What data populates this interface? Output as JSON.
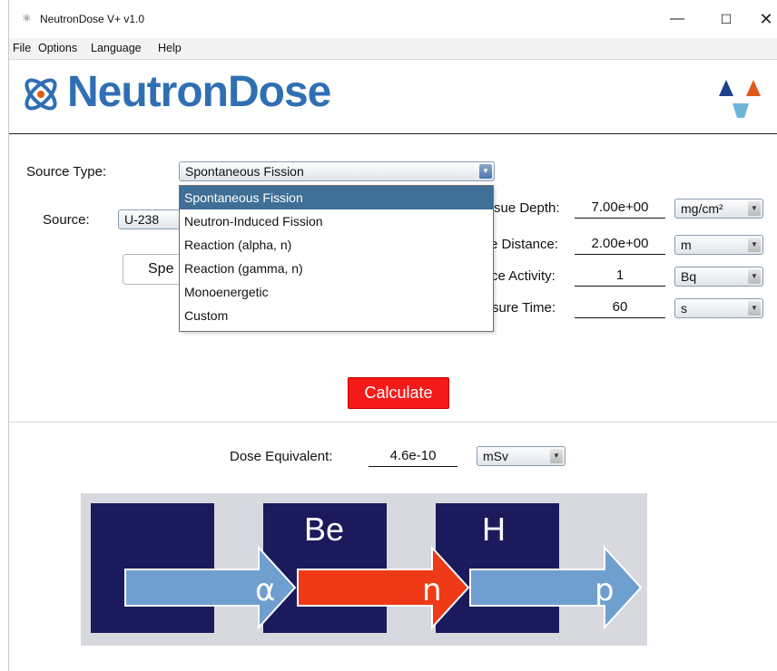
{
  "window": {
    "title": "NeutronDose  V+ v1.0",
    "controls": {
      "minimize": "—",
      "maximize": "☐",
      "close": "✕"
    }
  },
  "menu": [
    "File",
    "Options",
    "Language",
    "Help"
  ],
  "header": {
    "logo_text": "NeutronDose"
  },
  "form": {
    "source_type_label": "Source Type:",
    "source_type_value": "Spontaneous Fission",
    "source_label": "Source:",
    "source_value": "U-238",
    "spectrum_button_label": "Spe",
    "tissue_depth_label": "sue Depth:",
    "tissue_depth_value": "7.00e+00",
    "tissue_depth_unit": "mg/cm²",
    "distance_label": "e Distance:",
    "distance_value": "2.00e+00",
    "distance_unit": "m",
    "activity_label": "ce Activity:",
    "activity_value": "1",
    "activity_unit": "Bq",
    "time_label": "sure Time:",
    "time_value": "60",
    "time_unit": "s",
    "calculate_label": "Calculate"
  },
  "dropdown": {
    "options": [
      "Spontaneous Fission",
      "Neutron-Induced Fission",
      "Reaction (alpha, n)",
      "Reaction (gamma, n)",
      "Monoenergetic",
      "Custom"
    ],
    "selected_index": 0
  },
  "result": {
    "label": "Dose Equivalent:",
    "value": "4.6e-10",
    "unit": "mSv"
  },
  "diagram": {
    "box_labels": [
      "",
      "Be",
      "H"
    ],
    "arrow_labels": [
      "α",
      "n",
      "p"
    ],
    "colors": {
      "box": "#1b1a5c",
      "arrow_blue": "#6f9fcf",
      "arrow_red": "#ee3a16",
      "background": "#d8d9de"
    }
  },
  "colors": {
    "brand_blue": "#2f6fb4",
    "calculate_red": "#f51a1a",
    "accent_orange": "#e1591a"
  }
}
